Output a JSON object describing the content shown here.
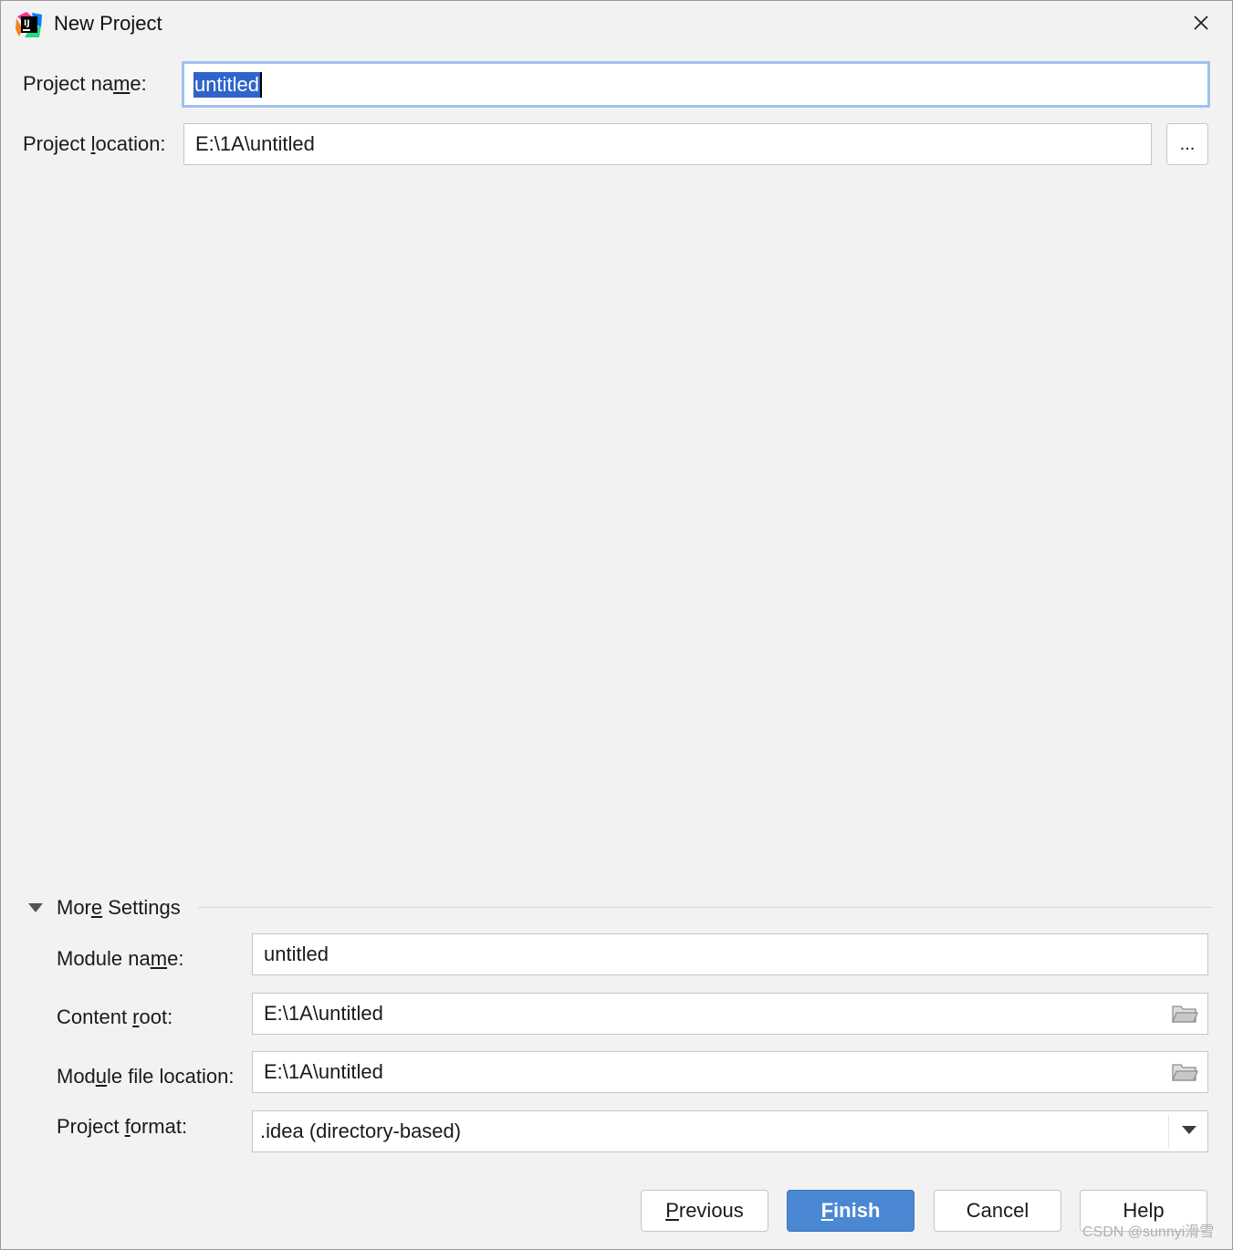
{
  "window": {
    "title": "New Project"
  },
  "project": {
    "name_label": "Project name:",
    "name_value": "untitled",
    "location_label": "Project location:",
    "location_value": "E:\\1A\\untitled",
    "browse_label": "..."
  },
  "more_settings": {
    "toggle_label": "More Settings",
    "expanded": true,
    "module_name_label": "Module name:",
    "module_name_value": "untitled",
    "content_root_label": "Content root:",
    "content_root_value": "E:\\1A\\untitled",
    "module_file_location_label": "Module file location:",
    "module_file_location_value": "E:\\1A\\untitled",
    "project_format_label": "Project format:",
    "project_format_value": ".idea (directory-based)"
  },
  "buttons": {
    "previous": "Previous",
    "finish": "Finish",
    "cancel": "Cancel",
    "help": "Help"
  },
  "watermark": "CSDN @sunnyi滑雪",
  "colors": {
    "accent": "#4a88d4",
    "selection": "#2f65ca",
    "focus_border": "#9ec2ee",
    "background": "#f2f2f2"
  },
  "icons": {
    "app": "intellij-idea-icon",
    "close": "close-icon",
    "folder": "folder-icon",
    "expand": "triangle-down-icon",
    "dropdown": "chevron-down-icon"
  }
}
